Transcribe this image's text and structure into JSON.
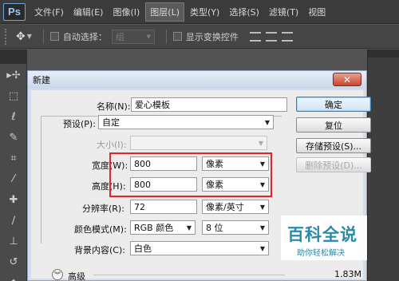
{
  "app": {
    "logo": "Ps"
  },
  "menu": {
    "items": [
      "文件(F)",
      "编辑(E)",
      "图像(I)",
      "图层(L)",
      "类型(Y)",
      "选择(S)",
      "滤镜(T)",
      "视图"
    ],
    "active_index": 3
  },
  "options_bar": {
    "auto_select_label": "自动选择：",
    "auto_select_value": "组",
    "show_transform_label": "显示变换控件"
  },
  "tools": [
    "move-icon",
    "marquee-icon",
    "lasso-icon",
    "quick-select-icon",
    "crop-icon",
    "eyedropper-icon",
    "healing-icon",
    "brush-icon",
    "stamp-icon",
    "history-brush-icon",
    "eraser-icon"
  ],
  "dialog": {
    "title": "新建",
    "name_label": "名称(N):",
    "name_value": "爱心模板",
    "preset_label": "预设(P):",
    "preset_value": "自定",
    "size_label": "大小(I):",
    "size_value": "",
    "width_label": "宽度(W):",
    "width_value": "800",
    "width_unit": "像素",
    "height_label": "高度(H):",
    "height_value": "800",
    "height_unit": "像素",
    "resolution_label": "分辨率(R):",
    "resolution_value": "72",
    "resolution_unit": "像素/英寸",
    "color_mode_label": "颜色模式(M):",
    "color_mode_value": "RGB 颜色",
    "bit_depth_value": "8 位",
    "background_label": "背景内容(C):",
    "background_value": "白色",
    "advanced_label": "高级",
    "image_size": "1.83M"
  },
  "buttons": {
    "ok": "确定",
    "reset": "复位",
    "save_preset": "存储预设(S)...",
    "delete_preset": "删除预设(D)..."
  },
  "watermark": {
    "main": "百科全说",
    "sub": "助你轻松解决"
  },
  "colors": {
    "highlight": "#e5232d",
    "watermark": "#2a8aa8"
  }
}
